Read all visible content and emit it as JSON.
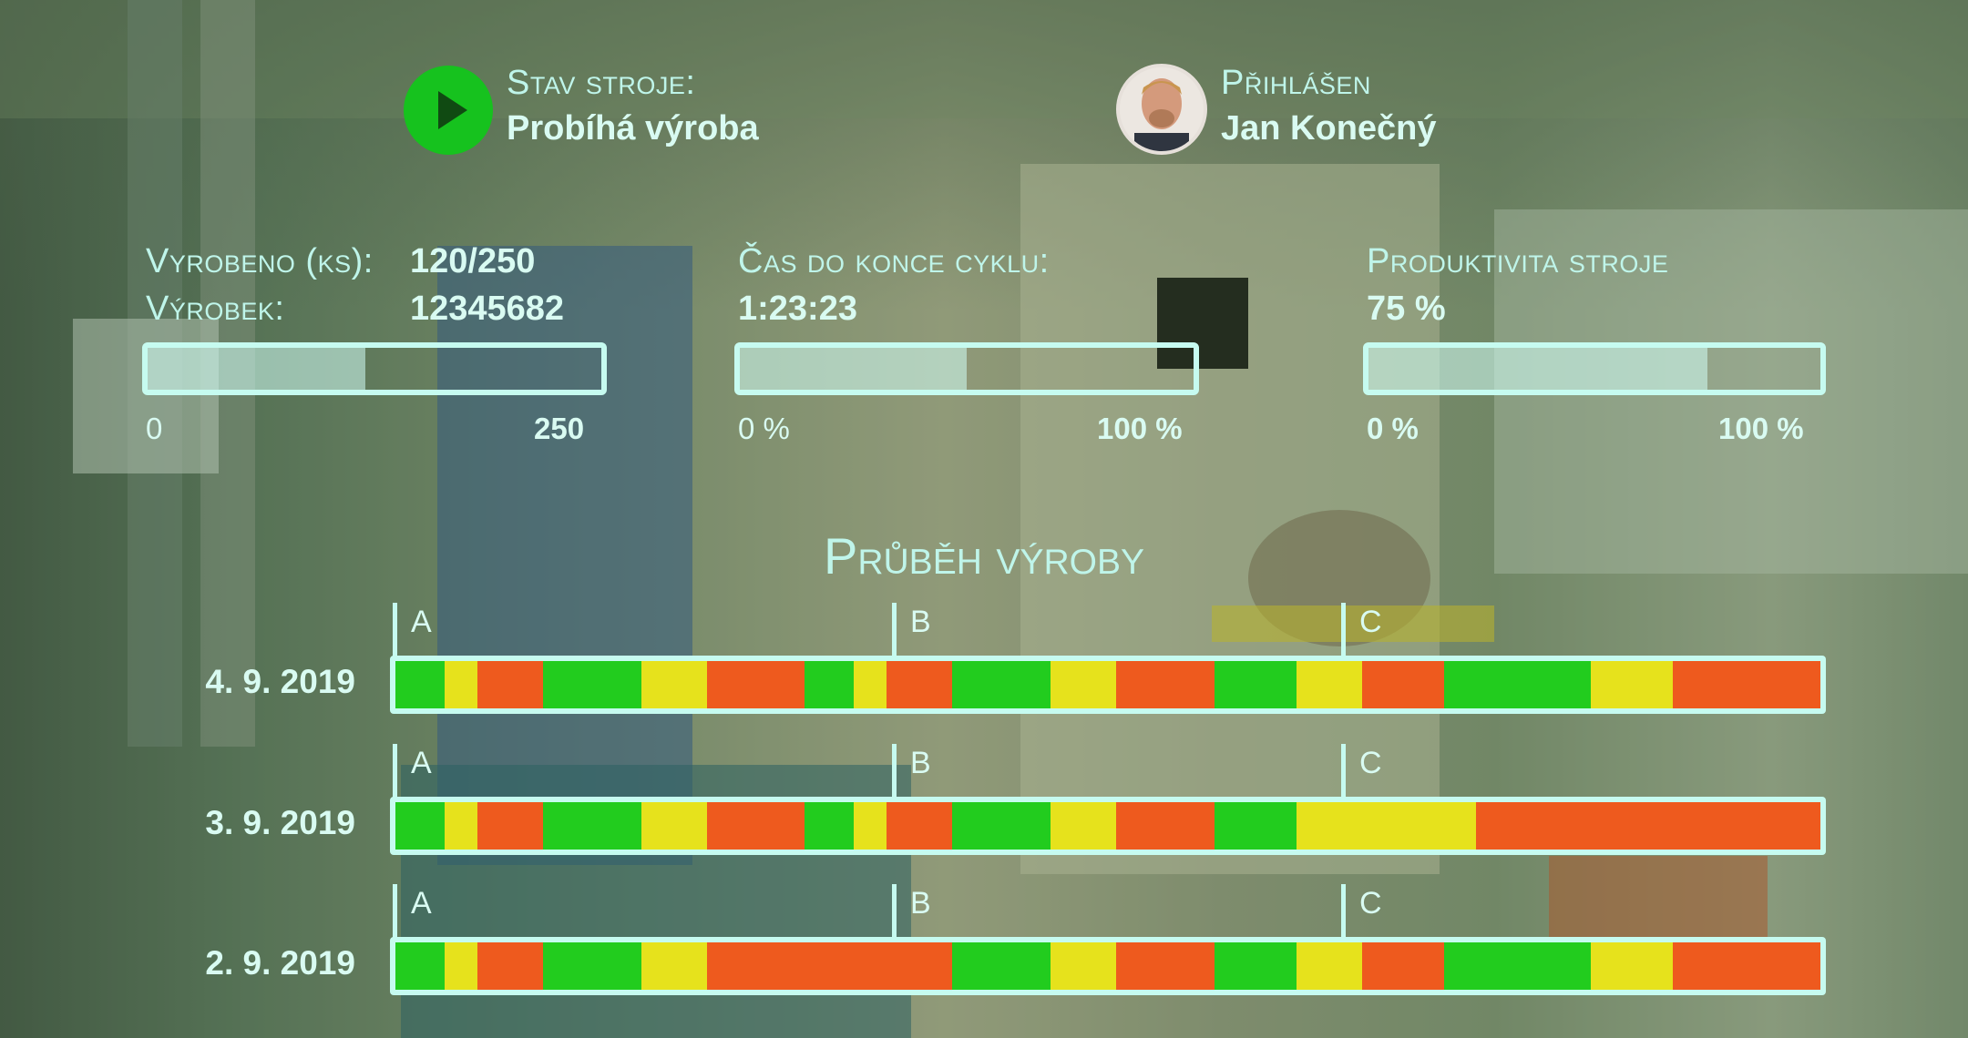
{
  "status": {
    "label": "Stav stroje:",
    "value": "Probíhá výroba",
    "icon": "play-icon",
    "color": "#16c21e"
  },
  "user": {
    "label": "Přihlášen",
    "name": "Jan Konečný",
    "icon": "avatar"
  },
  "metrics": {
    "produced": {
      "label": "Vyrobeno (ks):",
      "value": "120/250",
      "fraction": 0.48,
      "min_label": "0",
      "max_label": "250"
    },
    "product": {
      "label": "Výrobek:",
      "value": "12345682"
    },
    "cycle": {
      "label": "Čas do konce cyklu:",
      "value": "1:23:23",
      "fraction": 0.5,
      "min_label": "0 %",
      "max_label": "100 %"
    },
    "productivity": {
      "label": "Produktivita stroje",
      "value": "75 %",
      "fraction": 0.75,
      "min_label": "0 %",
      "max_label": "100 %"
    }
  },
  "timeline": {
    "title": "Průběh výroby",
    "shift_labels": [
      "A",
      "B",
      "C"
    ],
    "colors": {
      "green": "#22cc1e",
      "yellow": "#e6e21c",
      "red": "#ee5a1e",
      "frame": "#c6fbf0"
    },
    "days": [
      {
        "date": "4. 9. 2019",
        "segments": [
          {
            "state": "green",
            "span": 3
          },
          {
            "state": "yellow",
            "span": 2
          },
          {
            "state": "red",
            "span": 4
          },
          {
            "state": "green",
            "span": 6
          },
          {
            "state": "yellow",
            "span": 4
          },
          {
            "state": "red",
            "span": 6
          },
          {
            "state": "green",
            "span": 3
          },
          {
            "state": "yellow",
            "span": 2
          },
          {
            "state": "red",
            "span": 4
          },
          {
            "state": "green",
            "span": 6
          },
          {
            "state": "yellow",
            "span": 4
          },
          {
            "state": "red",
            "span": 6
          },
          {
            "state": "green",
            "span": 5
          },
          {
            "state": "yellow",
            "span": 4
          },
          {
            "state": "red",
            "span": 5
          },
          {
            "state": "green",
            "span": 9
          },
          {
            "state": "yellow",
            "span": 5
          },
          {
            "state": "red",
            "span": 9
          }
        ]
      },
      {
        "date": "3. 9. 2019",
        "segments": [
          {
            "state": "green",
            "span": 3
          },
          {
            "state": "yellow",
            "span": 2
          },
          {
            "state": "red",
            "span": 4
          },
          {
            "state": "green",
            "span": 6
          },
          {
            "state": "yellow",
            "span": 4
          },
          {
            "state": "red",
            "span": 6
          },
          {
            "state": "green",
            "span": 3
          },
          {
            "state": "yellow",
            "span": 2
          },
          {
            "state": "red",
            "span": 4
          },
          {
            "state": "green",
            "span": 6
          },
          {
            "state": "yellow",
            "span": 4
          },
          {
            "state": "red",
            "span": 6
          },
          {
            "state": "green",
            "span": 5
          },
          {
            "state": "yellow",
            "span": 11
          },
          {
            "state": "red",
            "span": 21
          }
        ]
      },
      {
        "date": "2. 9. 2019",
        "segments": [
          {
            "state": "green",
            "span": 3
          },
          {
            "state": "yellow",
            "span": 2
          },
          {
            "state": "red",
            "span": 4
          },
          {
            "state": "green",
            "span": 6
          },
          {
            "state": "yellow",
            "span": 4
          },
          {
            "state": "red",
            "span": 15
          },
          {
            "state": "green",
            "span": 6
          },
          {
            "state": "yellow",
            "span": 4
          },
          {
            "state": "red",
            "span": 6
          },
          {
            "state": "green",
            "span": 5
          },
          {
            "state": "yellow",
            "span": 4
          },
          {
            "state": "red",
            "span": 5
          },
          {
            "state": "green",
            "span": 9
          },
          {
            "state": "yellow",
            "span": 5
          },
          {
            "state": "red",
            "span": 9
          }
        ]
      }
    ]
  }
}
